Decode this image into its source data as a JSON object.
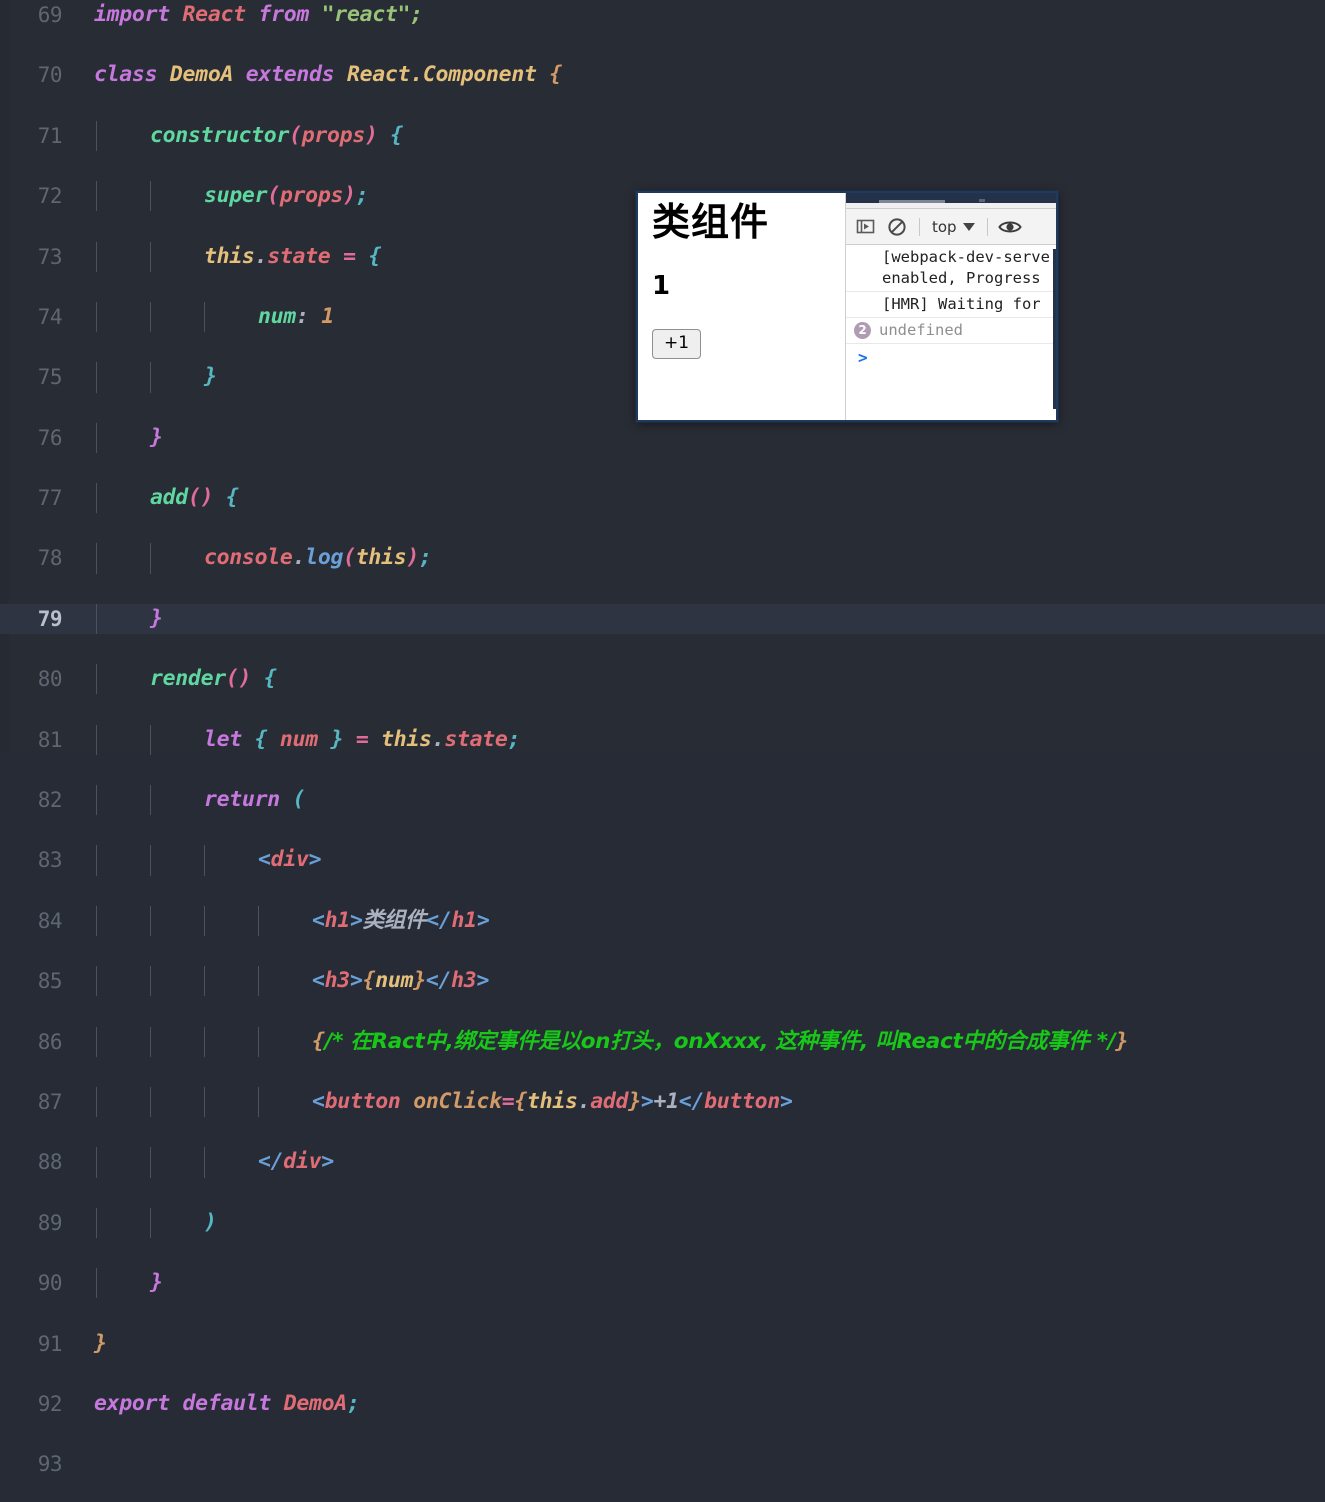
{
  "editor": {
    "first_line": 69,
    "active_line": 79,
    "lines": [
      {
        "n": 69,
        "text": "import React from \"react\";"
      },
      {
        "n": 70,
        "text": "class DemoA extends React.Component {"
      },
      {
        "n": 71,
        "text": "    constructor(props) {"
      },
      {
        "n": 72,
        "text": "        super(props);"
      },
      {
        "n": 73,
        "text": "        this.state = {"
      },
      {
        "n": 74,
        "text": "            num: 1"
      },
      {
        "n": 75,
        "text": "        }"
      },
      {
        "n": 76,
        "text": "    }"
      },
      {
        "n": 77,
        "text": "    add() {"
      },
      {
        "n": 78,
        "text": "        console.log(this);"
      },
      {
        "n": 79,
        "text": "    }"
      },
      {
        "n": 80,
        "text": "    render() {"
      },
      {
        "n": 81,
        "text": "        let { num } = this.state;"
      },
      {
        "n": 82,
        "text": "        return ("
      },
      {
        "n": 83,
        "text": "            <div>"
      },
      {
        "n": 84,
        "text": "                <h1>类组件</h1>"
      },
      {
        "n": 85,
        "text": "                <h3>{num}</h3>"
      },
      {
        "n": 86,
        "text": "                {/* 在Ract中,绑定事件是以on打头，onXxxx, 这种事件, 叫React中的合成事件 */}"
      },
      {
        "n": 87,
        "text": "                <button onClick={this.add}>+1</button>"
      },
      {
        "n": 88,
        "text": "            </div>"
      },
      {
        "n": 89,
        "text": "        )"
      },
      {
        "n": 90,
        "text": "    }"
      },
      {
        "n": 91,
        "text": "}"
      },
      {
        "n": 92,
        "text": "export default DemoA;"
      },
      {
        "n": 93,
        "text": ""
      }
    ],
    "line_numbers": [
      "69",
      "70",
      "71",
      "72",
      "73",
      "74",
      "75",
      "76",
      "77",
      "78",
      "79",
      "80",
      "81",
      "82",
      "83",
      "84",
      "85",
      "86",
      "87",
      "88",
      "89",
      "90",
      "91",
      "92",
      "93"
    ],
    "tokens": {
      "l69": {
        "import": "import",
        "React": "React",
        "from": "from",
        "react_str": "\"react\";"
      },
      "l70": {
        "class": "class",
        "DemoA": "DemoA",
        "extends": "extends",
        "ReactComponent": "React.Component",
        "brace": "{"
      },
      "l71": {
        "constructor": "constructor",
        "lparen": "(",
        "props": "props",
        "rparen": ")",
        "brace": "{"
      },
      "l72": {
        "super": "super",
        "lparen": "(",
        "props": "props",
        "rparen": ")",
        "semi": ";"
      },
      "l73": {
        "this": "this",
        "dot": ".",
        "state": "state",
        "eq": "=",
        "brace": "{"
      },
      "l74": {
        "num": "num",
        "colon": ":",
        "one": "1"
      },
      "l75": {
        "brace": "}"
      },
      "l76": {
        "brace": "}"
      },
      "l77": {
        "add": "add",
        "parens": "()",
        "brace": "{"
      },
      "l78": {
        "console": "console",
        "dot": ".",
        "log": "log",
        "lparen": "(",
        "this": "this",
        "rparen": ")",
        "semi": ";"
      },
      "l79": {
        "brace": "}"
      },
      "l80": {
        "render": "render",
        "parens": "()",
        "brace": "{"
      },
      "l81": {
        "let": "let",
        "lbrace": "{",
        "num": "num",
        "rbrace": "}",
        "eq": "=",
        "this": "this",
        "dot": ".",
        "state": "state",
        "semi": ";"
      },
      "l82": {
        "return": "return",
        "lparen": "("
      },
      "l83": {
        "lt": "<",
        "div": "div",
        "gt": ">"
      },
      "l84": {
        "open_lt": "<",
        "h1": "h1",
        "open_gt": ">",
        "content": "类组件",
        "close_lt": "</",
        "h1b": "h1",
        "close_gt": ">"
      },
      "l85": {
        "open_lt": "<",
        "h3": "h3",
        "open_gt": ">",
        "lbrace": "{",
        "num": "num",
        "rbrace": "}",
        "close_lt": "</",
        "h3b": "h3",
        "close_gt": ">"
      },
      "l86": {
        "lbrace": "{",
        "comment": "/* 在Ract中,绑定事件是以on打头，onXxxx, 这种事件, 叫React中的合成事件 */",
        "rbrace": "}"
      },
      "l87": {
        "lt": "<",
        "button": "button",
        "space": " ",
        "onClick": "onClick",
        "eq": "=",
        "lbrace": "{",
        "this": "this",
        "dot": ".",
        "add": "add",
        "rbrace": "}",
        "gt": ">",
        "plus1": "+1",
        "close_lt": "</",
        "buttonb": "button",
        "close_gt": ">"
      },
      "l88": {
        "close_lt": "</",
        "div": "div",
        "gt": ">"
      },
      "l89": {
        "rparen": ")"
      },
      "l90": {
        "brace": "}"
      },
      "l91": {
        "brace": "}"
      },
      "l92": {
        "export": "export",
        "default": "default",
        "DemoA": "DemoA",
        "semi": ";"
      }
    }
  },
  "popup": {
    "page": {
      "heading": "类组件",
      "count": "1",
      "button_label": "+1"
    },
    "devtools": {
      "toolbar": {
        "sidebar_toggle_icon": "sidebar-toggle-icon",
        "clear_console_icon": "clear-console-icon",
        "context_value": "top",
        "eye_icon": "live-expression-icon"
      },
      "messages": [
        {
          "text": "[webpack-dev-serve\nenabled, Progress",
          "count": null
        },
        {
          "text": "[HMR] Waiting for",
          "count": null
        },
        {
          "text": "undefined",
          "count": "2"
        }
      ],
      "prompt_symbol": ">"
    }
  },
  "colors": {
    "editor_bg": "#282c34",
    "active_line_bg": "#2f3443",
    "line_number": "#5f6672",
    "comment_green": "#18c718",
    "keyword_purple": "#c678dd",
    "string_green": "#98c379",
    "popup_border": "#1f3a5f",
    "devtools_tabbar": "#233249",
    "prompt_blue": "#1a73e8",
    "badge_purple": "#b09bb2"
  }
}
